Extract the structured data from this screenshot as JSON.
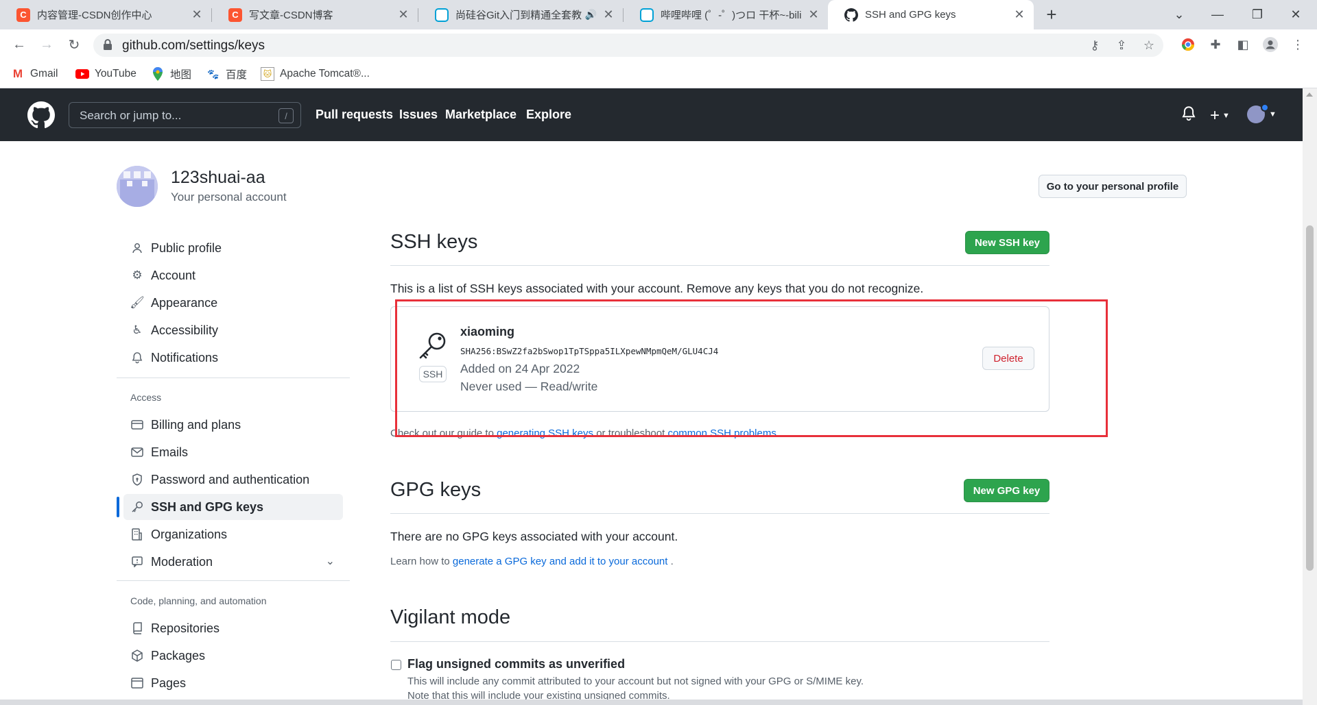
{
  "browser": {
    "tabs": [
      {
        "title": "内容管理-CSDN创作中心",
        "favicon": "csdn-icon",
        "active": false
      },
      {
        "title": "写文章-CSDN博客",
        "favicon": "csdn-icon",
        "active": false
      },
      {
        "title": "尚硅谷Git入门到精通全套教",
        "favicon": "bilibili-icon",
        "active": false
      },
      {
        "title": "哔哩哔哩 (゜-゜)つロ 干杯~-bili",
        "favicon": "bilibili-icon",
        "active": false
      },
      {
        "title": "SSH and GPG keys",
        "favicon": "github-icon",
        "active": true
      }
    ],
    "url": "github.com/settings/keys",
    "bookmarks": [
      {
        "label": "Gmail",
        "icon": "gmail-icon"
      },
      {
        "label": "YouTube",
        "icon": "youtube-icon"
      },
      {
        "label": "地图",
        "icon": "maps-icon"
      },
      {
        "label": "百度",
        "icon": "baidu-icon"
      },
      {
        "label": "Apache Tomcat®...",
        "icon": "tomcat-icon"
      }
    ]
  },
  "header": {
    "search_placeholder": "Search or jump to...",
    "search_shortcut": "/",
    "nav": [
      "Pull requests",
      "Issues",
      "Marketplace",
      "Explore"
    ]
  },
  "account": {
    "username": "123shuai-aa",
    "subtitle": "Your personal account",
    "profile_button": "Go to your personal profile"
  },
  "sidebar": {
    "items": [
      {
        "label": "Public profile",
        "icon": "person-icon"
      },
      {
        "label": "Account",
        "icon": "gear-icon"
      },
      {
        "label": "Appearance",
        "icon": "paintbrush-icon"
      },
      {
        "label": "Accessibility",
        "icon": "accessibility-icon"
      },
      {
        "label": "Notifications",
        "icon": "bell-icon"
      }
    ],
    "access_heading": "Access",
    "access_items": [
      {
        "label": "Billing and plans",
        "icon": "credit-card-icon"
      },
      {
        "label": "Emails",
        "icon": "mail-icon"
      },
      {
        "label": "Password and authentication",
        "icon": "shield-lock-icon"
      },
      {
        "label": "SSH and GPG keys",
        "icon": "key-icon",
        "active": true
      },
      {
        "label": "Organizations",
        "icon": "organization-icon"
      },
      {
        "label": "Moderation",
        "icon": "report-icon"
      }
    ],
    "code_heading": "Code, planning, and automation",
    "code_items": [
      {
        "label": "Repositories",
        "icon": "repo-icon"
      },
      {
        "label": "Packages",
        "icon": "package-icon"
      },
      {
        "label": "Pages",
        "icon": "browser-icon"
      }
    ]
  },
  "ssh": {
    "title": "SSH keys",
    "new_button": "New SSH key",
    "description": "This is a list of SSH keys associated with your account. Remove any keys that you do not recognize.",
    "key": {
      "name": "xiaoming",
      "fingerprint": "SHA256:BSwZ2fa2bSwop1TpTSppa5ILXpewNMpmQeM/GLU4CJ4",
      "added": "Added on 24 Apr 2022",
      "usage": "Never used — Read/write",
      "badge": "SSH",
      "delete_button": "Delete"
    },
    "guide_prefix": "Check out our guide to ",
    "guide_link1": "generating SSH keys",
    "guide_mid": " or troubleshoot ",
    "guide_link2": "common SSH problems",
    "guide_suffix": "."
  },
  "gpg": {
    "title": "GPG keys",
    "new_button": "New GPG key",
    "empty_text": "There are no GPG keys associated with your account.",
    "learn_prefix": "Learn how to ",
    "learn_link": "generate a GPG key and add it to your account",
    "learn_suffix": " ."
  },
  "vigilant": {
    "title": "Vigilant mode",
    "checkbox_label": "Flag unsigned commits as unverified",
    "note1": "This will include any commit attributed to your account but not signed with your GPG or S/MIME key.",
    "note2": "Note that this will include your existing unsigned commits."
  },
  "colors": {
    "header_bg": "#24292f",
    "green_button": "#2da44e",
    "delete_red": "#cf222e",
    "link_blue": "#0969da",
    "annotation_red": "#e8303a"
  }
}
